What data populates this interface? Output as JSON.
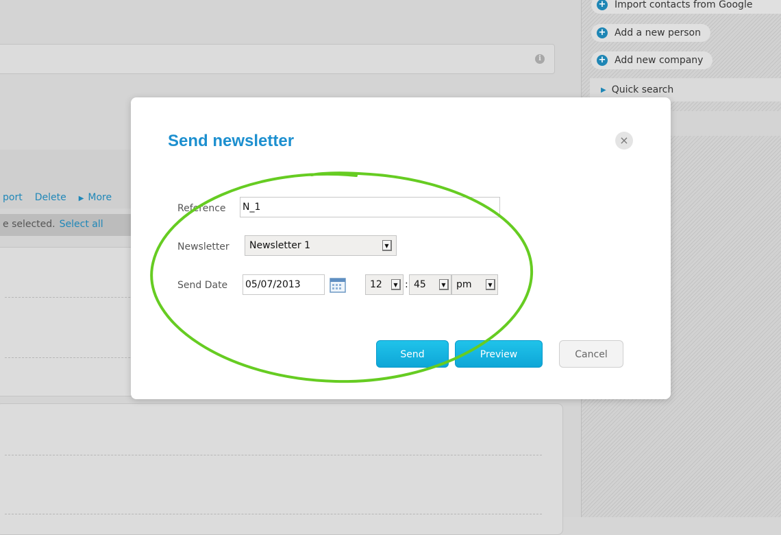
{
  "background": {
    "info_icon_glyph": "i",
    "actions": {
      "export": "port",
      "delete": "Delete",
      "more": "More"
    },
    "selection": {
      "text": "e selected.",
      "select_all": "Select all"
    }
  },
  "sidebar": {
    "items": [
      {
        "label": "Import contacts from Google",
        "icon": "plus-icon"
      },
      {
        "label": "Add a new person",
        "icon": "plus-icon"
      },
      {
        "label": "Add new company",
        "icon": "plus-icon"
      }
    ],
    "quick_search": "Quick search"
  },
  "modal": {
    "title": "Send newsletter",
    "close_glyph": "×",
    "reference": {
      "label": "Reference",
      "value": "N_1"
    },
    "newsletter": {
      "label": "Newsletter",
      "selected": "Newsletter 1"
    },
    "send_date": {
      "label": "Send Date",
      "date": "05/07/2013",
      "hour": "12",
      "minute": "45",
      "ampm": "pm",
      "separator": ":"
    },
    "buttons": {
      "send": "Send",
      "preview": "Preview",
      "cancel": "Cancel"
    }
  },
  "colors": {
    "accent": "#1c8fcf",
    "primary_button": "#12b2e0",
    "annotation_stroke": "#66cc22"
  }
}
